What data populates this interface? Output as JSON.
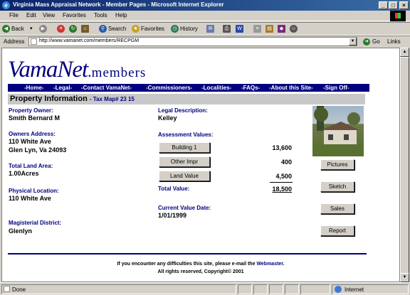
{
  "window": {
    "title": "Virginia Mass Appraisal Network - Member Pages - Microsoft Internet Explorer"
  },
  "menu": [
    "File",
    "Edit",
    "View",
    "Favorites",
    "Tools",
    "Help"
  ],
  "toolbar": {
    "back": "Back",
    "search": "Search",
    "favorites": "Favorites",
    "history": "History"
  },
  "address": {
    "label": "Address",
    "url": "http://www.vamanet.com/members/RECPGM",
    "go": "Go",
    "links": "Links"
  },
  "logo": {
    "main": "VamaNet",
    "dot": ".",
    "sub": "members"
  },
  "nav": [
    "-Home-",
    "-Legal-",
    "-Contact VamaNet-",
    "-Commissioners-",
    "-Localities-",
    "-FAQs-",
    "-About this Site-",
    "-Sign Off-"
  ],
  "property": {
    "header": "Property Information",
    "tax_map": "- Tax Map# 23 15",
    "owner_label": "Property Owner:",
    "owner": "Smith Bernard M",
    "address_label": "Owners Address:",
    "address_line1": "110 White Ave",
    "address_line2": "Glen Lyn, Va 24093",
    "land_area_label": "Total Land Area:",
    "land_area": "1.00Acres",
    "location_label": "Physical Location:",
    "location": "110 White Ave",
    "district_label": "Magisterial District:",
    "district": "Glenlyn",
    "legal_label": "Legal Description:",
    "legal": "Kelley",
    "assessment_label": "Assessment Values:",
    "building_btn": "Building 1",
    "building_val": "13,600",
    "other_btn": "Other Impr",
    "other_val": "400",
    "land_btn": "Land Value",
    "land_val": "4,500",
    "total_label": "Total Value:",
    "total_val": "18,500",
    "date_label": "Current Value Date:",
    "date": "1/01/1999"
  },
  "side_buttons": {
    "pictures": "Pictures",
    "sketch": "Sketch",
    "sales": "Sales",
    "report": "Report"
  },
  "footer": {
    "line1_pre": "If you encounter any difficulties this site, please e-mail the",
    "webmaster": "Webmaster",
    "line1_post": ".",
    "line2": "All rights reserved, Copyright© 2001"
  },
  "status": {
    "text": "Done",
    "zone": "Internet"
  }
}
